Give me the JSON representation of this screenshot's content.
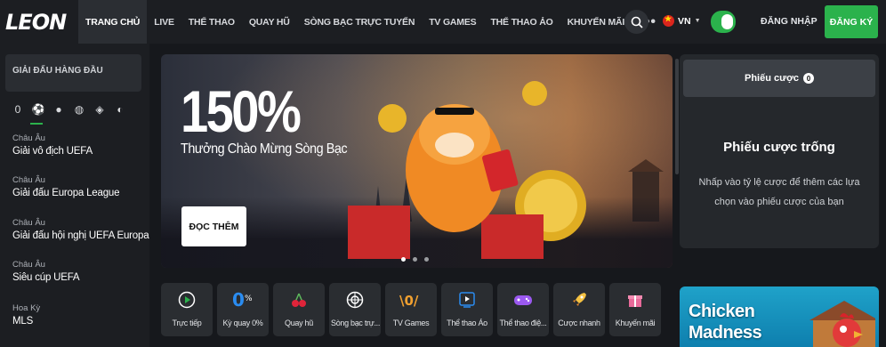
{
  "header": {
    "logo": "LEON",
    "nav": [
      {
        "label": "TRANG CHỦ",
        "active": true
      },
      {
        "label": "LIVE"
      },
      {
        "label": "THỂ THAO"
      },
      {
        "label": "QUAY HŨ"
      },
      {
        "label": "SÒNG BẠC TRỰC TUYẾN"
      },
      {
        "label": "TV GAMES"
      },
      {
        "label": "THỂ THAO ẢO"
      },
      {
        "label": "KHUYẾN MÃI"
      }
    ],
    "more_label": "•••",
    "language": "VN",
    "login_label": "ĐĂNG NHẬP",
    "register_label": "ĐĂNG KÝ"
  },
  "sidebar": {
    "heading": "GIẢI ĐẤU HÀNG ĐẦU",
    "sport_icons": [
      "all-sports-icon",
      "soccer-icon",
      "basketball-icon",
      "volleyball-icon",
      "esports-icon",
      "hockey-icon"
    ],
    "leagues": [
      {
        "region": "Châu Âu",
        "name": "Giải vô địch UEFA"
      },
      {
        "region": "Châu Âu",
        "name": "Giải đấu Europa League"
      },
      {
        "region": "Châu Âu",
        "name": "Giải đấu hội nghị UEFA Europa"
      },
      {
        "region": "Châu Âu",
        "name": "Siêu cúp UEFA"
      },
      {
        "region": "Hoa Kỳ",
        "name": "MLS"
      }
    ]
  },
  "banner": {
    "headline": "150%",
    "subline": "Thưởng Chào Mừng Sòng Bạc",
    "cta": "ĐỌC THÊM",
    "slides": 3,
    "active_slide": 1
  },
  "betslip": {
    "tab_label": "Phiếu cược",
    "count": "0",
    "empty_title": "Phiếu cược trống",
    "empty_desc": "Nhấp vào tỷ lệ cược để thêm các lựa chọn vào phiếu cược của bạn"
  },
  "quick_links": [
    {
      "label": "Trực tiếp",
      "icon": "play-circle-icon"
    },
    {
      "label": "Kỳ quay 0%",
      "icon": "zero-percent-icon"
    },
    {
      "label": "Quay hũ",
      "icon": "cherry-icon"
    },
    {
      "label": "Sòng bạc trự...",
      "icon": "roulette-icon"
    },
    {
      "label": "TV Games",
      "icon": "tv-games-icon"
    },
    {
      "label": "Thể thao Ảo",
      "icon": "virtual-play-icon"
    },
    {
      "label": "Thể thao điệ...",
      "icon": "gamepad-icon"
    },
    {
      "label": "Cược nhanh",
      "icon": "rocket-icon"
    },
    {
      "label": "Khuyến mãi",
      "icon": "gift-icon"
    }
  ],
  "promo": {
    "title_line1": "Chicken",
    "title_line2": "Madness"
  },
  "colors": {
    "brand_green": "#2bb24c",
    "background": "#16181c",
    "panel": "#25282c"
  }
}
